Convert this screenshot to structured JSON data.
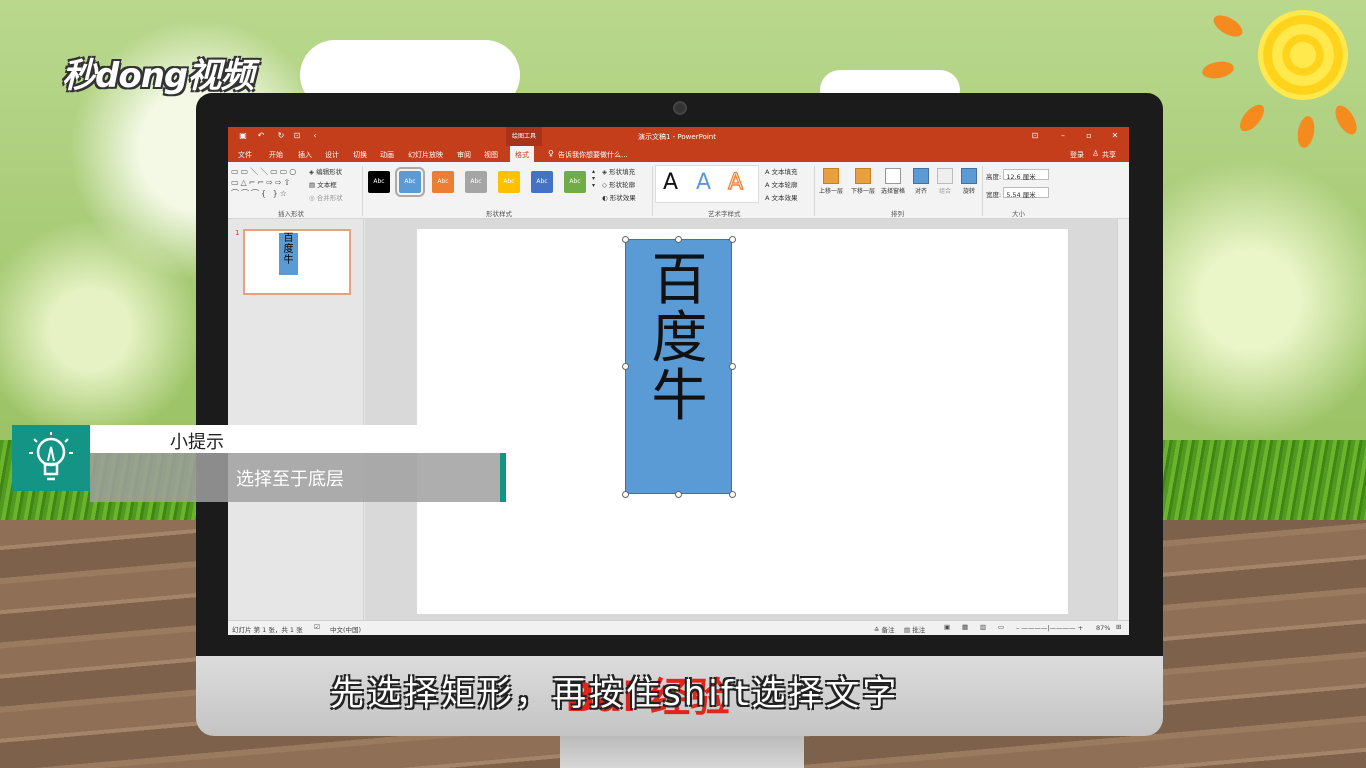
{
  "brand": {
    "logo_text": "秒dong视频",
    "watermark": "Bai 经验"
  },
  "window": {
    "title": "演示文稿1 - PowerPoint",
    "context_tab_group": "绘图工具",
    "sign_in": "登录",
    "share": "共享",
    "tell_me": "告诉我你想要做什么..."
  },
  "tabs": [
    "文件",
    "开始",
    "插入",
    "设计",
    "切换",
    "动画",
    "幻灯片放映",
    "审阅",
    "视图",
    "格式"
  ],
  "active_tab": "格式",
  "ribbon": {
    "insert_shapes": {
      "label": "插入形状",
      "edit_shape": "编辑形状",
      "text_box": "文本框",
      "merge_shapes": "合并形状"
    },
    "shape_styles": {
      "label": "形状样式",
      "swatch_text": "Abc",
      "swatches": [
        "#000000",
        "#5b9bd5",
        "#ed7d31",
        "#a5a5a5",
        "#ffc000",
        "#4472c4",
        "#70ad47"
      ],
      "fill": "形状填充",
      "outline": "形状轮廓",
      "effects": "形状效果"
    },
    "wordart": {
      "label": "艺术字样式",
      "letter": "A",
      "text_fill": "文本填充",
      "text_outline": "文本轮廓",
      "text_effects": "文本效果"
    },
    "arrange": {
      "label": "排列",
      "bring_forward": "上移一层",
      "send_backward": "下移一层",
      "selection_pane": "选择窗格",
      "align": "对齐",
      "group": "组合",
      "rotate": "旋转"
    },
    "size": {
      "label": "大小",
      "height_label": "高度:",
      "height_value": "12.6 厘米",
      "width_label": "宽度:",
      "width_value": "5.54 厘米"
    }
  },
  "slide": {
    "number": "1",
    "rect_text": "百度牛",
    "rect_color": "#5b9bd5"
  },
  "status": {
    "slide_info": "幻灯片 第 1 张，共 1 张",
    "language": "中文(中国)",
    "notes": "备注",
    "comments": "批注",
    "zoom": "87%"
  },
  "tip": {
    "title": "小提示",
    "text": "选择至于底层"
  },
  "subtitle": "先选择矩形，再按住shift选择文字"
}
